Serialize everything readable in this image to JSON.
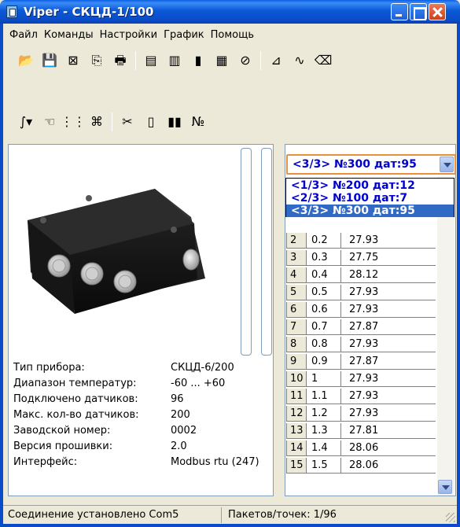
{
  "window": {
    "title": "Viper - СКЦД-1/100"
  },
  "menu": [
    "Файл",
    "Команды",
    "Настройки",
    "График",
    "Помощь"
  ],
  "toolbar1": [
    {
      "icon": "open-folder-icon",
      "glyph": "📂"
    },
    {
      "icon": "save-icon",
      "glyph": "💾"
    },
    {
      "icon": "excel-icon",
      "glyph": "⊠"
    },
    {
      "icon": "copy-icon",
      "glyph": "⎘"
    },
    {
      "icon": "print-icon",
      "glyph": "🖶"
    },
    {
      "icon": "separator"
    },
    {
      "icon": "device-icon-a",
      "glyph": "▤"
    },
    {
      "icon": "device-icon-b",
      "glyph": "▥"
    },
    {
      "icon": "battery-icon",
      "glyph": "▮"
    },
    {
      "icon": "calendar-icon",
      "glyph": "▦"
    },
    {
      "icon": "clock-icon",
      "glyph": "⊘"
    },
    {
      "icon": "separator"
    },
    {
      "icon": "chart-icon",
      "glyph": "⊿"
    },
    {
      "icon": "line-chart-icon",
      "glyph": "∿"
    },
    {
      "icon": "eraser-icon",
      "glyph": "⌫"
    }
  ],
  "toolbar2": [
    {
      "icon": "curve-dropdown-icon",
      "glyph": "∫▾"
    },
    {
      "icon": "hand-icon",
      "glyph": "☜"
    },
    {
      "icon": "sensors-icon",
      "glyph": "⋮⋮"
    },
    {
      "icon": "sensor-config-icon",
      "glyph": "⌘"
    },
    {
      "icon": "separator"
    },
    {
      "icon": "tools-icon",
      "glyph": "✂"
    },
    {
      "icon": "page-icon",
      "glyph": "▯"
    },
    {
      "icon": "bars-icon",
      "glyph": "▮▮"
    },
    {
      "icon": "number-icon",
      "glyph": "№"
    }
  ],
  "device_info": [
    {
      "label": "Тип прибора:",
      "value": "СКЦД-6/200"
    },
    {
      "label": "Диапазон температур:",
      "value": "-60 ... +60"
    },
    {
      "label": "Подключено датчиков:",
      "value": "96"
    },
    {
      "label": "Макс. кол-во датчиков:",
      "value": "200"
    },
    {
      "label": "Заводской номер:",
      "value": "0002"
    },
    {
      "label": "Версия прошивки:",
      "value": "2.0"
    },
    {
      "label": "Интерфейс:",
      "value": "Modbus rtu (247)"
    }
  ],
  "combo": {
    "selected": "<3/3> №300 дат:95",
    "options": [
      "<1/3> №200 дат:12",
      "<2/3> №100 дат:7",
      "<3/3> №300 дат:95"
    ]
  },
  "table_rows": [
    [
      "2",
      "0.2",
      "27.93"
    ],
    [
      "3",
      "0.3",
      "27.75"
    ],
    [
      "4",
      "0.4",
      "28.12"
    ],
    [
      "5",
      "0.5",
      "27.93"
    ],
    [
      "6",
      "0.6",
      "27.93"
    ],
    [
      "7",
      "0.7",
      "27.87"
    ],
    [
      "8",
      "0.8",
      "27.93"
    ],
    [
      "9",
      "0.9",
      "27.87"
    ],
    [
      "10",
      "1",
      "27.93"
    ],
    [
      "11",
      "1.1",
      "27.93"
    ],
    [
      "12",
      "1.2",
      "27.93"
    ],
    [
      "13",
      "1.3",
      "27.81"
    ],
    [
      "14",
      "1.4",
      "28.06"
    ],
    [
      "15",
      "1.5",
      "28.06"
    ]
  ],
  "status": {
    "connection": "Соединение установлено Com5",
    "packets": "Пакетов/точек: 1/96"
  }
}
